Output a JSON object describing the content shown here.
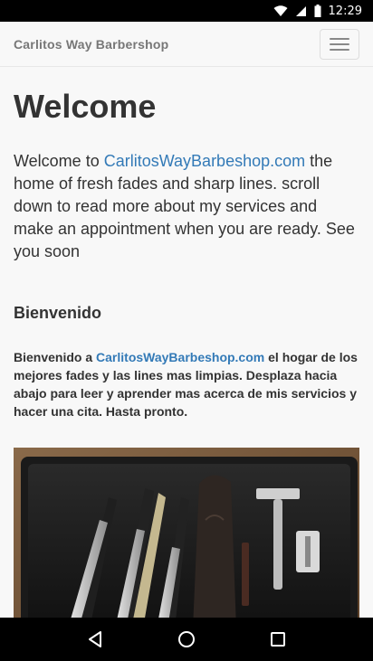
{
  "status_bar": {
    "time": "12:29",
    "icons": [
      "wifi-icon",
      "signal-icon",
      "battery-icon"
    ]
  },
  "navbar": {
    "brand": "Carlitos Way Barbershop",
    "menu_icon": "hamburger-menu-icon"
  },
  "main": {
    "heading": "Welcome",
    "intro_prefix": "Welcome to ",
    "intro_link": "CarlitosWayBarbeshop.com",
    "intro_suffix": " the home of fresh fades and sharp lines. scroll down to read more about my services and make an appointment when you are ready. See you soon",
    "spanish_heading": "Bienvenido",
    "spanish_prefix": "Bienvenido a ",
    "spanish_link": "CarlitosWayBarbeshop.com",
    "spanish_suffix": " el hogar de los mejores fades y las lines mas limpias. Desplaza hacia abajo para leer y aprender mas acerca de mis servicios y hacer una cita. Hasta pronto."
  },
  "system_nav": {
    "icons": [
      "back-icon",
      "home-icon",
      "recents-icon"
    ]
  },
  "colors": {
    "link": "#337ab7",
    "text": "#333333",
    "navbar_bg": "#f8f8f8"
  }
}
